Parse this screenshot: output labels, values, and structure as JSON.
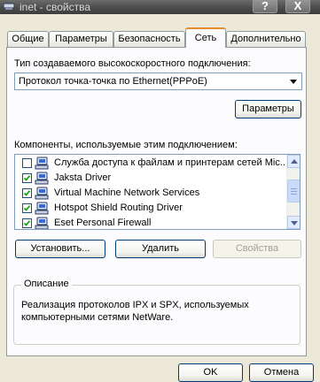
{
  "window": {
    "title": "inet - свойства",
    "help_glyph": "?",
    "close_glyph": "X",
    "icon": "network-connection-icon"
  },
  "tabs": [
    {
      "label": "Общие",
      "active": false
    },
    {
      "label": "Параметры",
      "active": false
    },
    {
      "label": "Безопасность",
      "active": false
    },
    {
      "label": "Сеть",
      "active": true
    },
    {
      "label": "Дополнительно",
      "active": false
    }
  ],
  "network": {
    "connection_type_label": "Тип создаваемого высокоскоростного подключения:",
    "connection_type_value": "Протокол точка-точка по Ethernet(PPPoE)",
    "settings_button": "Параметры",
    "components_label": "Компоненты, используемые этим подключением:",
    "components": [
      {
        "label": "Служба доступа к файлам и принтерам сетей Mic...",
        "checked": false,
        "icon": "network-service-icon"
      },
      {
        "label": "Jaksta Driver",
        "checked": true,
        "icon": "network-service-icon"
      },
      {
        "label": "Virtual Machine Network Services",
        "checked": true,
        "icon": "network-service-icon"
      },
      {
        "label": "Hotspot Shield Routing Driver",
        "checked": true,
        "icon": "network-service-icon"
      },
      {
        "label": "Eset Personal Firewall",
        "checked": true,
        "icon": "network-service-icon"
      }
    ],
    "install_button": "Установить...",
    "remove_button": "Удалить",
    "properties_button": "Свойства",
    "properties_enabled": false,
    "description_title": "Описание",
    "description_text": "Реализация протоколов IPX и SPX, используемых компьютерными сетями NetWare."
  },
  "footer": {
    "ok_button": "OK",
    "cancel_button": "Отмена"
  },
  "colors": {
    "dialog_bg": "#ece9d8",
    "panel_bg": "#fcfcfe",
    "active_tab_accent": "#e68b2c",
    "titlebar": "#4e4e4e"
  }
}
